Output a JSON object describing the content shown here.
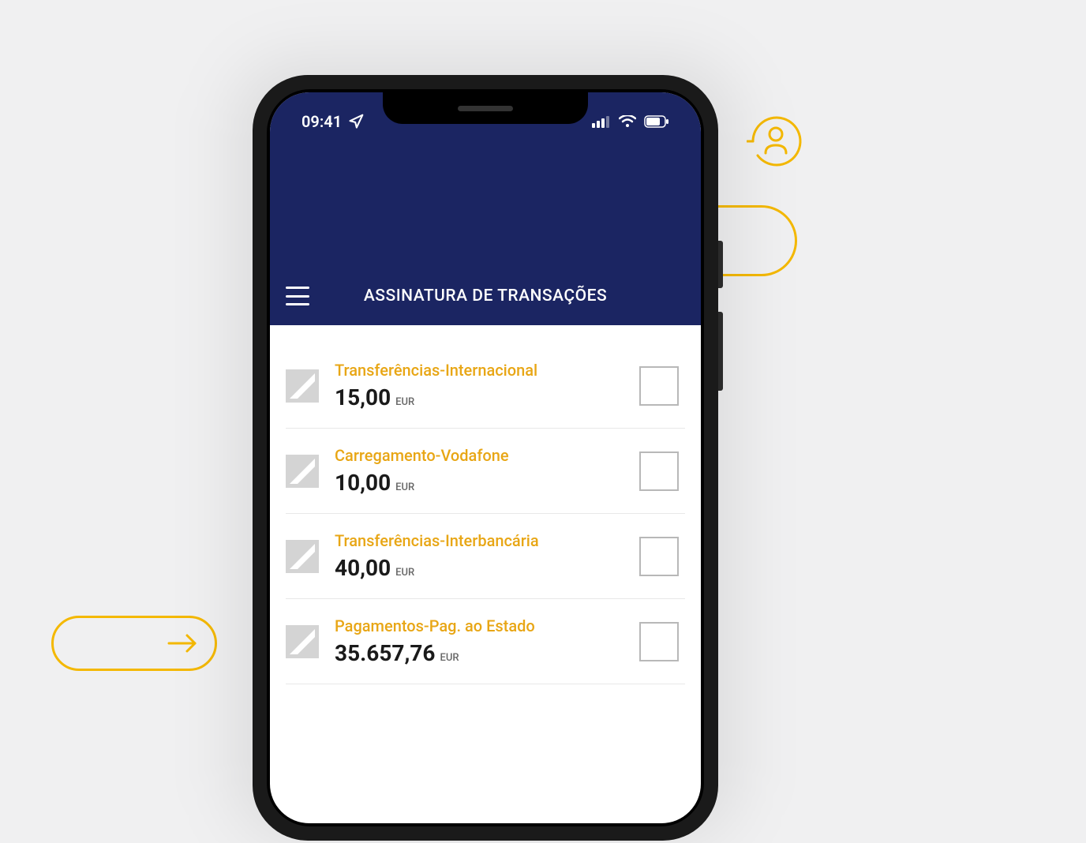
{
  "colors": {
    "accent": "#F4B800",
    "header_bg": "#1B2562",
    "tx_title": "#E8A615"
  },
  "status_bar": {
    "time": "09:41"
  },
  "header": {
    "title": "ASSINATURA DE TRANSAÇÕES"
  },
  "transactions": [
    {
      "title": "Transferências-Internacional",
      "amount": "15,00",
      "currency": "EUR"
    },
    {
      "title": "Carregamento-Vodafone",
      "amount": "10,00",
      "currency": "EUR"
    },
    {
      "title": "Transferências-Interbancária",
      "amount": "40,00",
      "currency": "EUR"
    },
    {
      "title": "Pagamentos-Pag. ao Estado",
      "amount": "35.657,76",
      "currency": "EUR"
    }
  ]
}
